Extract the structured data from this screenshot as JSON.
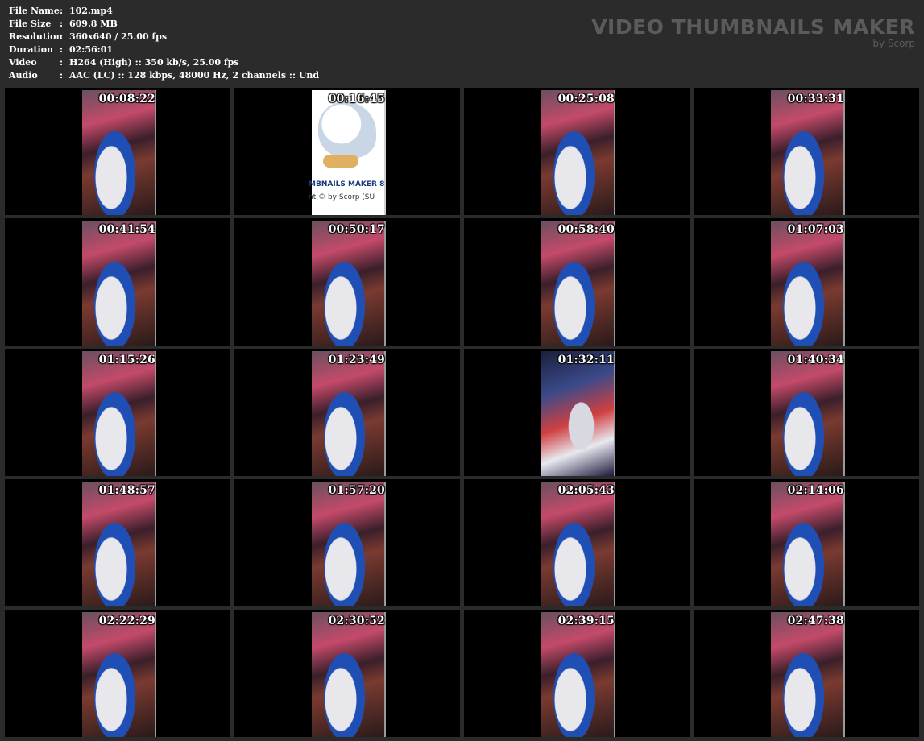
{
  "info": {
    "rows": [
      {
        "key": "File Name",
        "value": "102.mp4"
      },
      {
        "key": "File Size",
        "value": "609.8 MB"
      },
      {
        "key": "Resolution",
        "value": "360x640 / 25.00 fps"
      },
      {
        "key": "Duration",
        "value": "02:56:01"
      },
      {
        "key": "Video",
        "value": "H264 (High) :: 350 kb/s, 25.00 fps"
      },
      {
        "key": "Audio",
        "value": "AAC (LC) :: 128 kbps, 48000 Hz, 2 channels :: Und"
      }
    ],
    "separator": ":"
  },
  "brand": {
    "title": "VIDEO THUMBNAILS MAKER",
    "subtitle": "by Scorp"
  },
  "ad_frame": {
    "line1": "MBNAILS MAKER 8",
    "line2": "nt © by Scorp (SU"
  },
  "thumbnails": [
    {
      "time": "00:08:22"
    },
    {
      "time": "00:16:45"
    },
    {
      "time": "00:25:08"
    },
    {
      "time": "00:33:31"
    },
    {
      "time": "00:41:54"
    },
    {
      "time": "00:50:17"
    },
    {
      "time": "00:58:40"
    },
    {
      "time": "01:07:03"
    },
    {
      "time": "01:15:26"
    },
    {
      "time": "01:23:49"
    },
    {
      "time": "01:32:11"
    },
    {
      "time": "01:40:34"
    },
    {
      "time": "01:48:57"
    },
    {
      "time": "01:57:20"
    },
    {
      "time": "02:05:43"
    },
    {
      "time": "02:14:06"
    },
    {
      "time": "02:22:29"
    },
    {
      "time": "02:30:52"
    },
    {
      "time": "02:39:15"
    },
    {
      "time": "02:47:38"
    }
  ]
}
